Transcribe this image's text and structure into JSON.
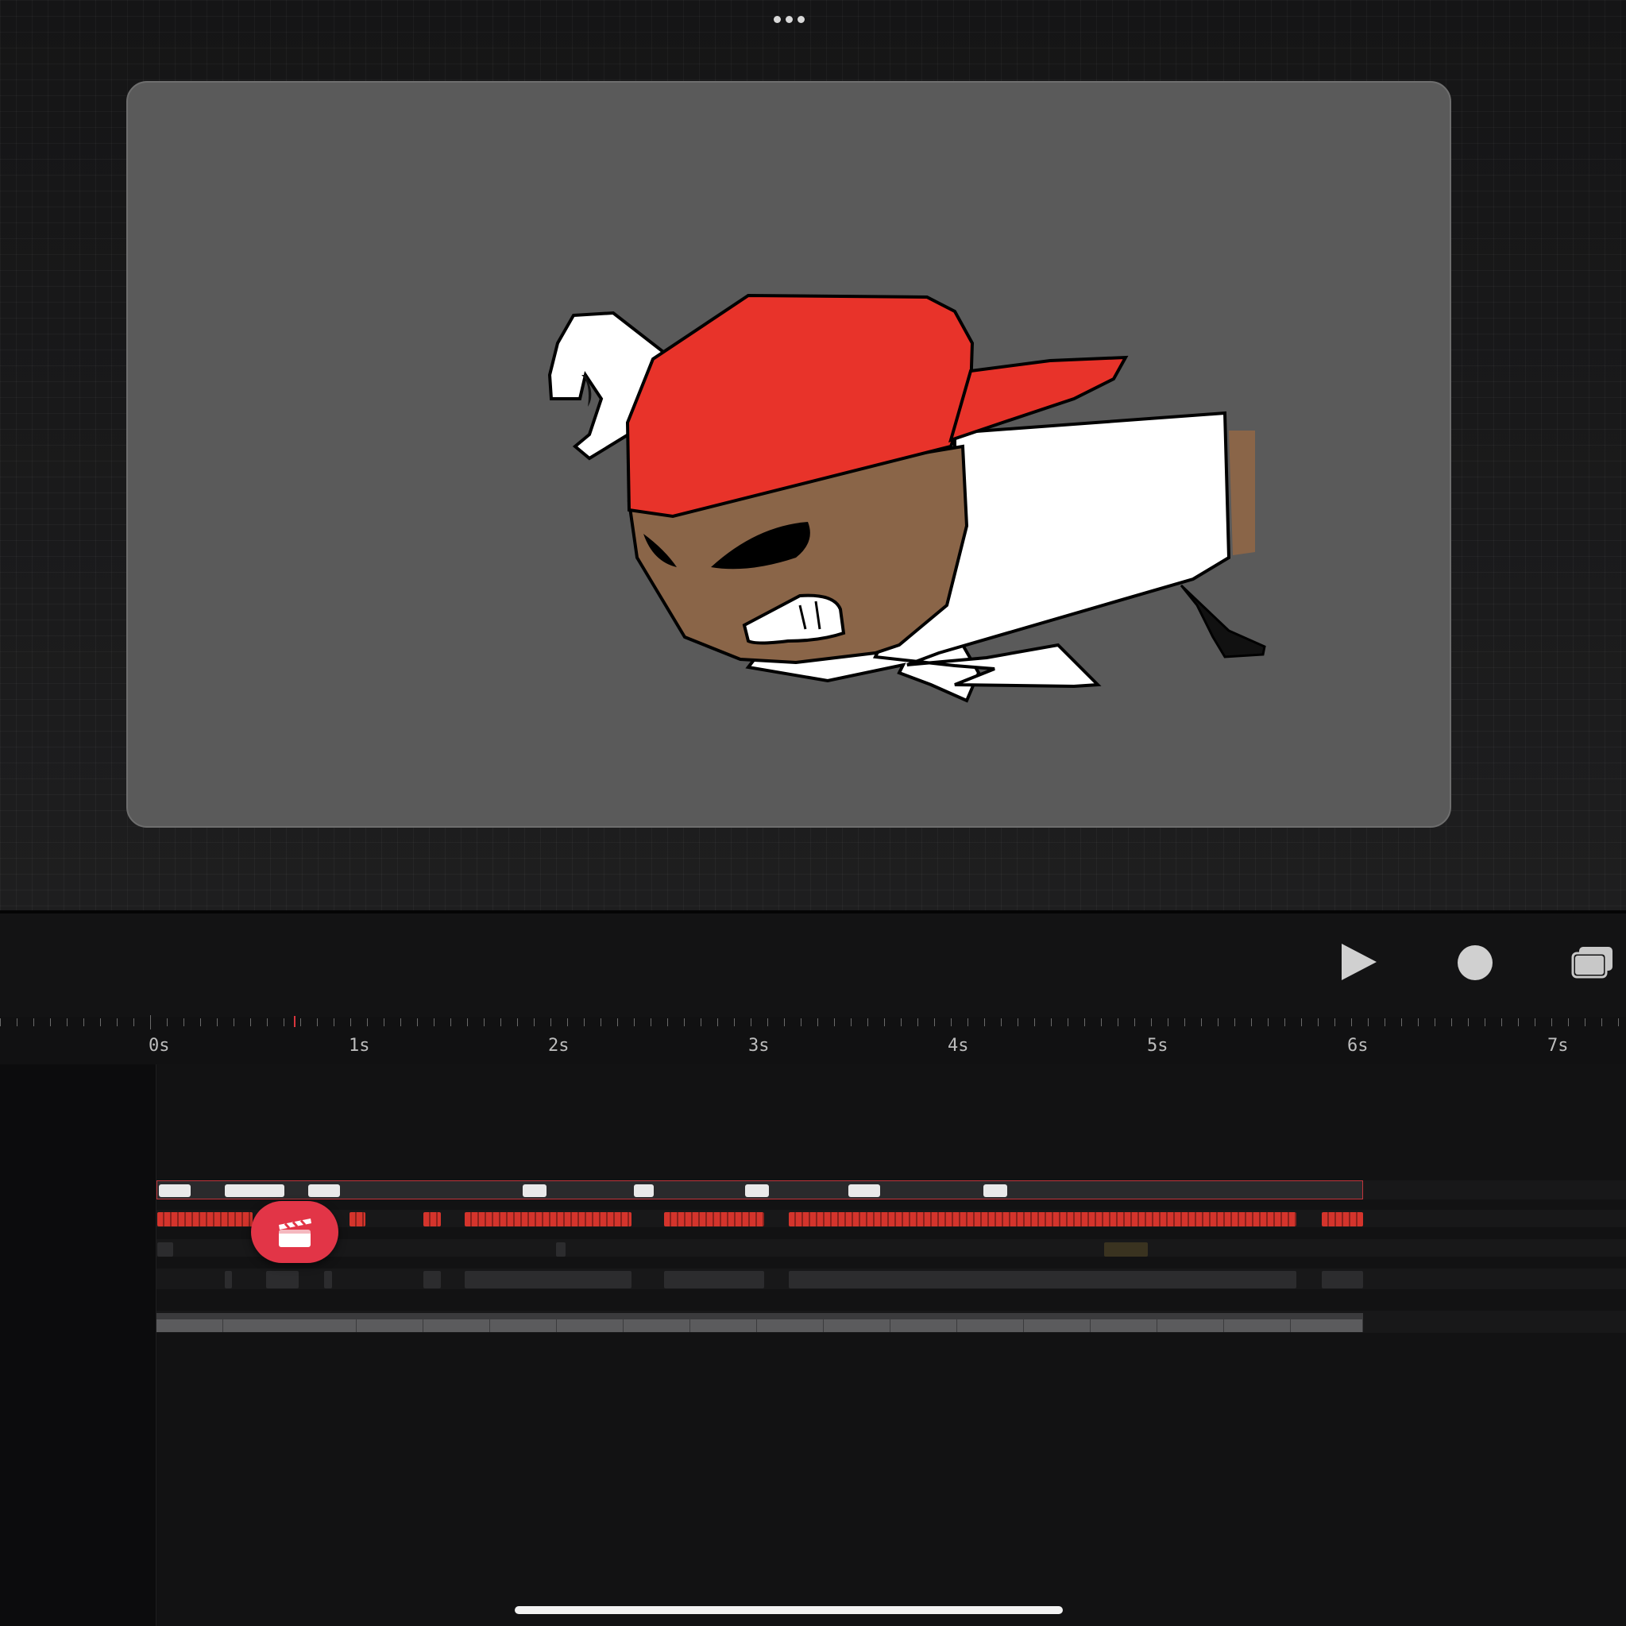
{
  "header": {
    "more_icon": "ellipsis-icon"
  },
  "canvas": {
    "background_color": "#5a5a5a",
    "content": "cartoon character with red cap"
  },
  "toolbar": {
    "play_icon": "play-icon",
    "record_icon": "record-icon",
    "layers_icon": "layers-icon"
  },
  "timeline": {
    "ruler_labels": [
      "0s",
      "1s",
      "2s",
      "3s",
      "4s",
      "5s",
      "6s",
      "7s"
    ],
    "accent_color": "#d4342c",
    "fab_icon": "clapperboard-icon",
    "fab_color": "#e23547"
  }
}
